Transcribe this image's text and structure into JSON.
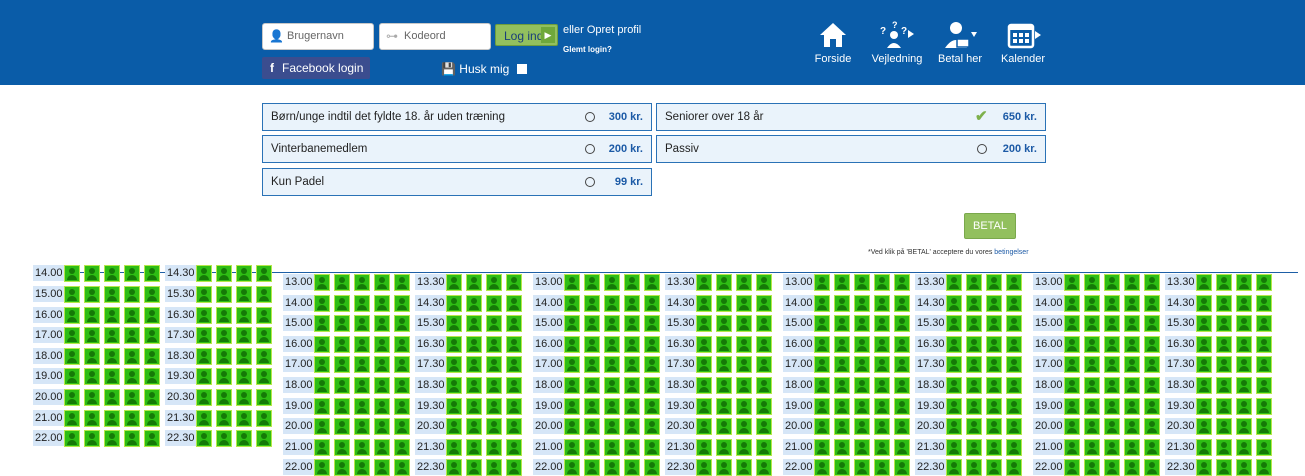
{
  "header": {
    "username_placeholder": "Brugernavn",
    "password_placeholder": "Kodeord",
    "login_label": "Log ind",
    "or_create": "eller Opret profil",
    "forgot": "Glemt login?",
    "facebook_label": "Facebook login",
    "remember_label": "Husk mig",
    "nav": [
      {
        "label": "Forside",
        "icon": "home-icon"
      },
      {
        "label": "Vejledning",
        "icon": "help-person-icon"
      },
      {
        "label": "Betal her",
        "icon": "pay-person-icon"
      },
      {
        "label": "Kalender",
        "icon": "calendar-icon"
      }
    ]
  },
  "options": [
    {
      "label": "Børn/unge indtil det fyldte 18. år uden træning",
      "price": "300 kr.",
      "selected": false
    },
    {
      "label": "Seniorer over 18 år",
      "price": "650 kr.",
      "selected": true
    },
    {
      "label": "Vinterbanemedlem",
      "price": "200 kr.",
      "selected": false
    },
    {
      "label": "Passiv",
      "price": "200 kr.",
      "selected": false
    },
    {
      "label": "Kun Padel",
      "price": "99 kr.",
      "selected": false
    }
  ],
  "betal_label": "BETAL",
  "terms_text": "*Ved klik på 'BETAL' acceptere du vores ",
  "terms_link": "betingelser",
  "schedule": {
    "clipped_top": [
      "14.00",
      "14.30"
    ],
    "first_times": [
      "15.00",
      "16.00",
      "17.00",
      "18.00",
      "19.00",
      "20.00",
      "21.00",
      "22.00"
    ],
    "first_times_half": [
      "15.30",
      "16.30",
      "17.30",
      "18.30",
      "19.30",
      "20.30",
      "21.30",
      "22.30"
    ],
    "times": [
      "13.00",
      "14.00",
      "15.00",
      "16.00",
      "17.00",
      "18.00",
      "19.00",
      "20.00",
      "21.00",
      "22.00"
    ],
    "times_half": [
      "13.30",
      "14.30",
      "15.30",
      "16.30",
      "17.30",
      "18.30",
      "19.30",
      "20.30",
      "21.30",
      "22.30"
    ],
    "slot_status": "available",
    "colors": {
      "available": "#2ebd14",
      "border": "#b5e84a",
      "time_bg": "#d6e6f7"
    }
  }
}
